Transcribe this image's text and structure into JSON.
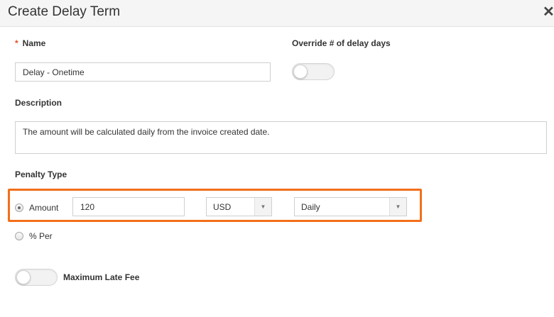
{
  "dialog": {
    "title": "Create Delay Term",
    "close_glyph": "✕"
  },
  "name": {
    "required_mark": "*",
    "label": "Name",
    "value": "Delay - Onetime"
  },
  "override": {
    "label": "Override # of delay days",
    "enabled": false
  },
  "description": {
    "label": "Description",
    "value": "The amount will be calculated daily from the invoice created date."
  },
  "penalty": {
    "label": "Penalty Type",
    "options": [
      {
        "label": "Amount",
        "checked": true
      },
      {
        "label": "% Per",
        "checked": false
      }
    ],
    "amount_value": "120",
    "currency": "USD",
    "frequency": "Daily",
    "dropdown_glyph": "▼",
    "highlight_color": "#f26f1a"
  },
  "max_late_fee": {
    "label": "Maximum Late Fee",
    "enabled": false
  }
}
